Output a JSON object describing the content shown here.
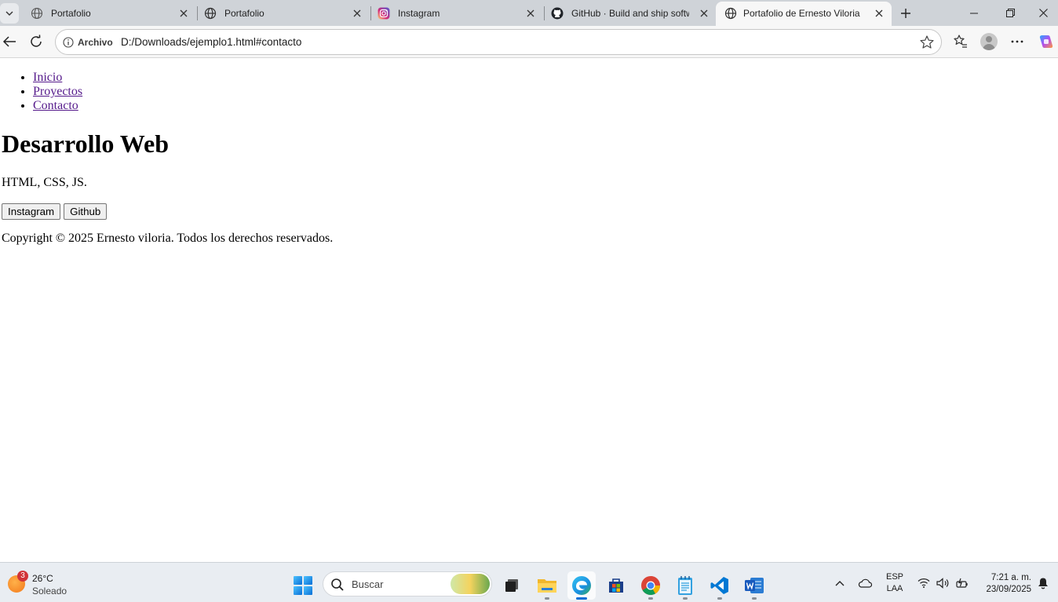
{
  "browser": {
    "tabs": [
      {
        "title": "Portafolio",
        "favicon": "globe-icon",
        "active": false
      },
      {
        "title": "Portafolio",
        "favicon": "globe-icon",
        "active": false
      },
      {
        "title": "Instagram",
        "favicon": "instagram-icon",
        "active": false
      },
      {
        "title": "GitHub · Build and ship softwa",
        "favicon": "github-icon",
        "active": false
      },
      {
        "title": "Portafolio de Ernesto Viloria",
        "favicon": "globe-icon",
        "active": true
      }
    ],
    "address": {
      "origin_label": "Archivo",
      "url": "D:/Downloads/ejemplo1.html#contacto"
    }
  },
  "page": {
    "nav": [
      "Inicio",
      "Proyectos",
      "Contacto"
    ],
    "heading": "Desarrollo Web",
    "description": "HTML, CSS, JS.",
    "buttons": [
      "Instagram",
      "Github"
    ],
    "copyright": "Copyright © 2025 Ernesto viloria. Todos los derechos reservados."
  },
  "taskbar": {
    "weather": {
      "temp": "26°C",
      "condition": "Soleado",
      "badge": "3"
    },
    "search_label": "Buscar",
    "apps": [
      "task-view-icon",
      "file-explorer-icon",
      "edge-icon",
      "store-icon",
      "chrome-icon",
      "notepad-icon",
      "vscode-icon",
      "word-icon"
    ],
    "language": {
      "line1": "ESP",
      "line2": "LAA"
    },
    "clock": {
      "time": "7:21 a. m.",
      "date": "23/09/2025"
    }
  },
  "colors": {
    "link_visited": "#551a8b",
    "tab_strip": "#cfd3d8",
    "taskbar": "#e9edf2",
    "accent": "#0a6fd6"
  }
}
